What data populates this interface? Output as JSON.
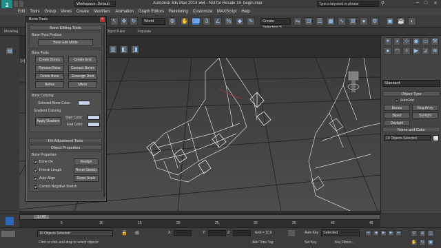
{
  "titlebar": {
    "workspace_label": "Workspace: Default",
    "title": "Autodesk 3ds Max  2014 x64  - Not for Resale   19_begin.max",
    "search_placeholder": "Type a keyword or phrase",
    "logo_text": "3"
  },
  "menubar": {
    "items": [
      "Edit",
      "Tools",
      "Group",
      "Views",
      "Create",
      "Modifiers",
      "Animation",
      "Graph Editors",
      "Rendering",
      "Customize",
      "MAXScript",
      "Help"
    ]
  },
  "toolbar": {
    "refcoord": "World",
    "selection_set": "Create Selection S"
  },
  "ribbon": {
    "items": [
      "Modeling",
      "Object Paint",
      "Populate"
    ]
  },
  "viewport": {
    "label": "[+]"
  },
  "bone_tools": {
    "window_title": "Bone Tools",
    "editing_header": "Bone Editing Tools",
    "pivot_label": "Bone Pivot Position",
    "edit_mode": "Bone Edit Mode",
    "tools_label": "Bone Tools",
    "create_bones": "Create Bones",
    "create_end": "Create End",
    "remove_bone": "Remove Bone",
    "connect_bones": "Connect Bones",
    "delete_bone": "Delete Bone",
    "reassign_root": "Reassign Root",
    "refine": "Refine",
    "mirror": "Mirror",
    "coloring_label": "Bone Coloring",
    "selected_color_label": "Selected Bone Color:",
    "gradient_label": "Gradient Coloring",
    "apply_gradient": "Apply Gradient",
    "start_color": "Start Color:",
    "end_color": "End Color:",
    "fin_header": "Fin Adjustment Tools",
    "object_props_header": "Object Properties",
    "bone_props_label": "Bone Properties",
    "bone_on": "Bone On",
    "realign": "Realign",
    "freeze_length": "Freeze Length",
    "reset_stretch": "Reset Stretch",
    "auto_align": "Auto-Align",
    "reset_scale": "Reset Scale",
    "correct_neg": "Correct Negative Stretch"
  },
  "cmdpanel": {
    "category": "Standard",
    "object_type_header": "Object Type",
    "autogrid": "AutoGrid",
    "buttons": [
      "Bones",
      "Ring Array",
      "Biped",
      "Sunlight",
      "Daylight"
    ],
    "name_color_header": "Name and Color",
    "name_field": "10 Objects Selected"
  },
  "timeline": {
    "frame": "1 / 47",
    "ticks": [
      "5",
      "10",
      "15",
      "20",
      "25",
      "30",
      "35",
      "40",
      "45"
    ]
  },
  "statusbar": {
    "selection": "10 Objects Selected",
    "hint": "Click or click-and-drag to select objects",
    "x_label": "X:",
    "y_label": "Y:",
    "z_label": "Z:",
    "grid": "Grid = 10.0",
    "add_time_tag": "Add Time Tag",
    "auto_key": "Auto Key",
    "selected_dd": "Selected",
    "set_key": "Set Key",
    "key_filters": "Key Filters..."
  }
}
